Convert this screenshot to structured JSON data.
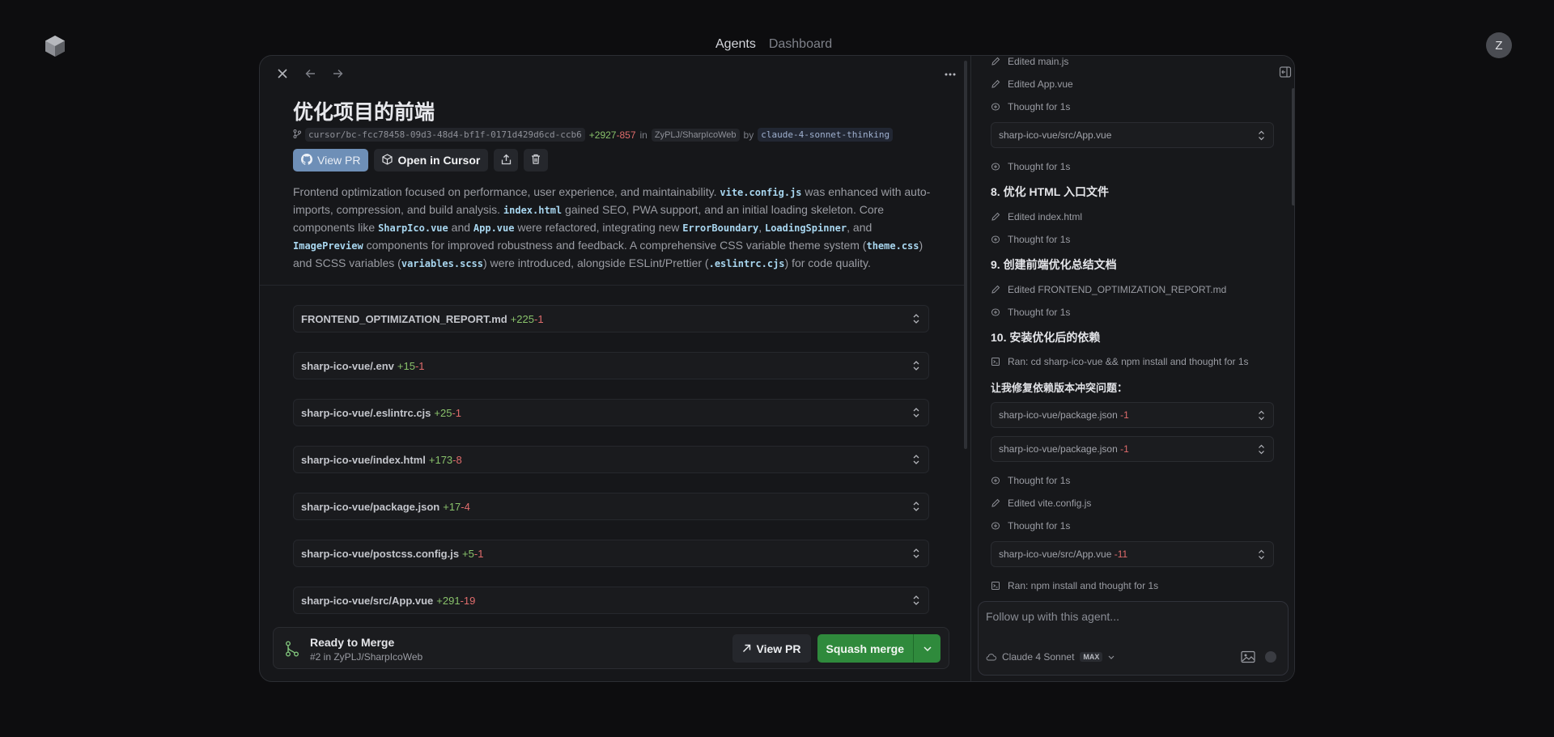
{
  "nav": {
    "agents": "Agents",
    "dashboard": "Dashboard"
  },
  "user": {
    "avatar_initial": "Z"
  },
  "header": {
    "title": "优化项目的前端",
    "branch": "cursor/bc-fcc78458-09d3-48d4-bf1f-0171d429d6cd-ccb6",
    "additions": "+2927",
    "deletions": "-857",
    "in_label": "in",
    "repo": "ZyPLJ/SharpIcoWeb",
    "by_label": "by",
    "model": "claude-4-sonnet-thinking"
  },
  "actions": {
    "view_pr": "View PR",
    "open_in_cursor": "Open in Cursor"
  },
  "summary": {
    "t1": "Frontend optimization focused on performance, user experience, and maintainability. ",
    "c1": "vite.config.js",
    "t2": " was enhanced with auto-imports, compression, and build analysis. ",
    "c2": "index.html",
    "t3": " gained SEO, PWA support, and an initial loading skeleton. Core components like ",
    "c3": "SharpIco.vue",
    "t4": " and ",
    "c4": "App.vue",
    "t5": " were refactored, integrating new ",
    "c5": "ErrorBoundary",
    "t6": ", ",
    "c6": "LoadingSpinner",
    "t7": ", and ",
    "c7": "ImagePreview",
    "t8": " components for improved robustness and feedback. A comprehensive CSS variable theme system (",
    "c8": "theme.css",
    "t9": ") and SCSS variables (",
    "c9": "variables.scss",
    "t10": ") were introduced, alongside ESLint/Prettier (",
    "c10": ".eslintrc.cjs",
    "t11": ") for code quality."
  },
  "files": [
    {
      "name": "FRONTEND_OPTIMIZATION_REPORT.md",
      "add": "+225",
      "del": "-1"
    },
    {
      "name": "sharp-ico-vue/.env",
      "add": "+15",
      "del": "-1"
    },
    {
      "name": "sharp-ico-vue/.eslintrc.cjs",
      "add": "+25",
      "del": "-1"
    },
    {
      "name": "sharp-ico-vue/index.html",
      "add": "+173",
      "del": "-8"
    },
    {
      "name": "sharp-ico-vue/package.json",
      "add": "+17",
      "del": "-4"
    },
    {
      "name": "sharp-ico-vue/postcss.config.js",
      "add": "+5",
      "del": "-1"
    },
    {
      "name": "sharp-ico-vue/src/App.vue",
      "add": "+291",
      "del": "-19"
    }
  ],
  "merge": {
    "title": "Ready to Merge",
    "subtitle": "#2 in ZyPLJ/SharpIcoWeb",
    "view_pr": "View PR",
    "squash": "Squash merge"
  },
  "timeline": {
    "edited_main": "Edited main.js",
    "edited_app": "Edited App.vue",
    "thought1": "Thought for 1s",
    "file_app": "sharp-ico-vue/src/App.vue",
    "thought2": "Thought for 1s",
    "heading8": "8. 优化 HTML 入口文件",
    "edited_index": "Edited index.html",
    "thought3": "Thought for 1s",
    "heading9": "9. 创建前端优化总结文档",
    "edited_report": "Edited FRONTEND_OPTIMIZATION_REPORT.md",
    "thought4": "Thought for 1s",
    "heading10": "10. 安装优化后的依赖",
    "ran1": "Ran: cd sharp-ico-vue && npm install and thought for 1s",
    "fix_text": "让我修复依赖版本冲突问题：",
    "file_pkg1": "sharp-ico-vue/package.json",
    "file_pkg1_del": "-1",
    "file_pkg2": "sharp-ico-vue/package.json",
    "file_pkg2_del": "-1",
    "thought5": "Thought for 1s",
    "edited_vite": "Edited vite.config.js",
    "thought6": "Thought for 1s",
    "file_app2": "sharp-ico-vue/src/App.vue",
    "file_app2_del": "-11",
    "ran2": "Ran: npm install and thought for 1s"
  },
  "composer": {
    "placeholder": "Follow up with this agent...",
    "model": "Claude 4 Sonnet",
    "badge": "MAX"
  }
}
